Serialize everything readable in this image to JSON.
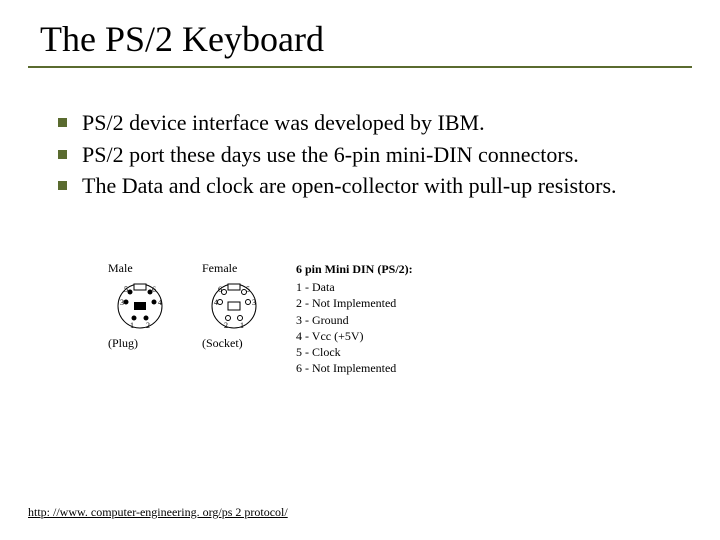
{
  "title": "The PS/2 Keyboard",
  "bullets": [
    "PS/2 device interface was developed by IBM.",
    "PS/2 port these days use the 6-pin mini-DIN connectors.",
    "The Data and clock are open-collector with pull-up resistors."
  ],
  "figure": {
    "male": {
      "label": "Male",
      "caption": "(Plug)"
    },
    "female": {
      "label": "Female",
      "caption": "(Socket)"
    },
    "pinout": {
      "title": "6 pin Mini DIN (PS/2):",
      "lines": [
        "1 - Data",
        "2 - Not Implemented",
        "3 - Ground",
        "4 - Vcc (+5V)",
        "5 - Clock",
        "6 - Not Implemented"
      ]
    }
  },
  "footer_link": "http: //www. computer-engineering. org/ps 2 protocol/"
}
